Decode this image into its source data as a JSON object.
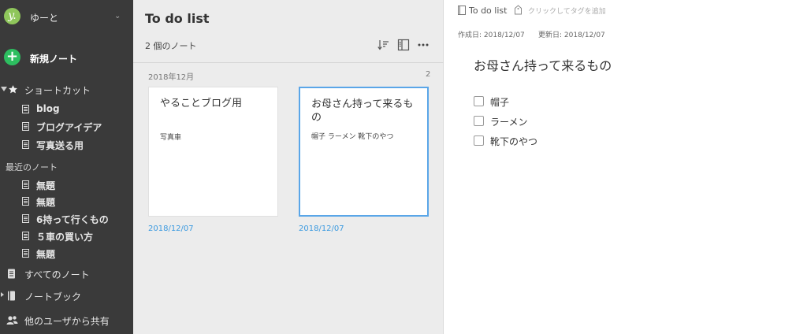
{
  "sidebar": {
    "account": {
      "avatar_letter": "y.",
      "name": "ゆーと"
    },
    "new_note_label": "新規ノート",
    "shortcuts": {
      "label": "ショートカット",
      "items": [
        {
          "label": "blog"
        },
        {
          "label": "ブログアイデア"
        },
        {
          "label": "写真送る用"
        }
      ]
    },
    "recent": {
      "label": "最近のノート",
      "items": [
        {
          "label": "無題"
        },
        {
          "label": "無題"
        },
        {
          "label": "6持って行くもの"
        },
        {
          "label": "５車の買い方"
        },
        {
          "label": "無題"
        }
      ]
    },
    "all_notes_label": "すべてのノート",
    "notebooks_label": "ノートブック",
    "shared_label": "他のユーザから共有"
  },
  "list": {
    "title": "To do list",
    "note_count": "2 個のノート",
    "group": {
      "label": "2018年12月",
      "count": "2"
    },
    "cards": [
      {
        "title": "やることブログ用",
        "snippet": "写真車",
        "date": "2018/12/07",
        "selected": false
      },
      {
        "title": "お母さん持って来るもの",
        "snippet": "帽子 ラーメン 靴下のやつ",
        "date": "2018/12/07",
        "selected": true
      }
    ]
  },
  "editor": {
    "notebook": "To do list",
    "tag_placeholder": "クリックしてタグを追加",
    "created": "作成日: 2018/12/07",
    "updated": "更新日: 2018/12/07",
    "title": "お母さん持って来るもの",
    "todos": [
      {
        "text": "帽子",
        "checked": false
      },
      {
        "text": "ラーメン",
        "checked": false
      },
      {
        "text": "靴下のやつ",
        "checked": false
      }
    ]
  },
  "colors": {
    "sidebar_bg": "#3a3a3a",
    "accent_green": "#2dbe60",
    "accent_blue": "#3b9ae0",
    "selected_border": "#5aa6e8"
  },
  "icons": [
    "chevron-down-icon",
    "plus-icon",
    "star-icon",
    "note-icon",
    "notes-stack-icon",
    "notebook-icon",
    "people-icon",
    "sort-icon",
    "view-icon",
    "more-icon",
    "tag-icon"
  ]
}
